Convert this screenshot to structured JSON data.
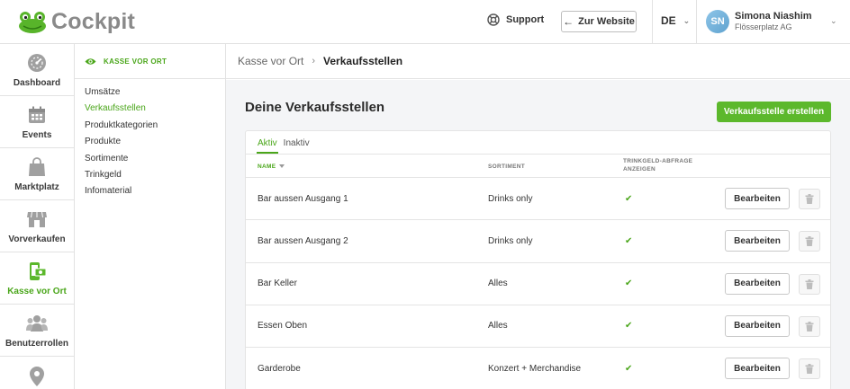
{
  "app": {
    "brand": "Cockpit"
  },
  "header": {
    "support_label": "Support",
    "website_label": "Zur Website",
    "language": "DE",
    "user": {
      "initials": "SN",
      "name": "Simona Niashim",
      "company": "Flösserplatz AG"
    }
  },
  "leftnav": {
    "items": [
      {
        "label": "Dashboard",
        "icon": "dashboard-icon"
      },
      {
        "label": "Events",
        "icon": "calendar-icon"
      },
      {
        "label": "Marktplatz",
        "icon": "shopping-bag-icon"
      },
      {
        "label": "Vorverkaufen",
        "icon": "store-icon"
      },
      {
        "label": "Kasse vor Ort",
        "icon": "mobile-cash-icon",
        "active": true
      },
      {
        "label": "Benutzerrollen",
        "icon": "users-icon"
      },
      {
        "label": "",
        "icon": "location-pin-icon"
      }
    ]
  },
  "subnav": {
    "title": "KASSE VOR ORT",
    "links": [
      "Umsätze",
      "Verkaufsstellen",
      "Produktkategorien",
      "Produkte",
      "Sortimente",
      "Trinkgeld",
      "Infomaterial"
    ],
    "active_index": 1
  },
  "breadcrumb": {
    "parent": "Kasse vor Ort",
    "current": "Verkaufsstellen"
  },
  "main": {
    "title": "Deine Verkaufsstellen",
    "create_label": "Verkaufsstelle erstellen",
    "tabs": [
      "Aktiv",
      "Inaktiv"
    ],
    "columns": {
      "name": "NAME",
      "sortiment": "SORTIMENT",
      "tip_line1": "TRINKGELD-ABFRAGE",
      "tip_line2": "ANZEIGEN"
    },
    "edit_label": "Bearbeiten",
    "check_glyph": "✔",
    "rows": [
      {
        "name": "Bar aussen Ausgang 1",
        "sortiment": "Drinks only",
        "tip": true
      },
      {
        "name": "Bar aussen Ausgang 2",
        "sortiment": "Drinks only",
        "tip": true
      },
      {
        "name": "Bar Keller",
        "sortiment": "Alles",
        "tip": true
      },
      {
        "name": "Essen Oben",
        "sortiment": "Alles",
        "tip": true
      },
      {
        "name": "Garderobe",
        "sortiment": "Konzert + Merchandise",
        "tip": true
      }
    ]
  },
  "colors": {
    "accent": "#5cb82c",
    "accent_text": "#4aa61a",
    "muted": "#8a8a8a"
  }
}
